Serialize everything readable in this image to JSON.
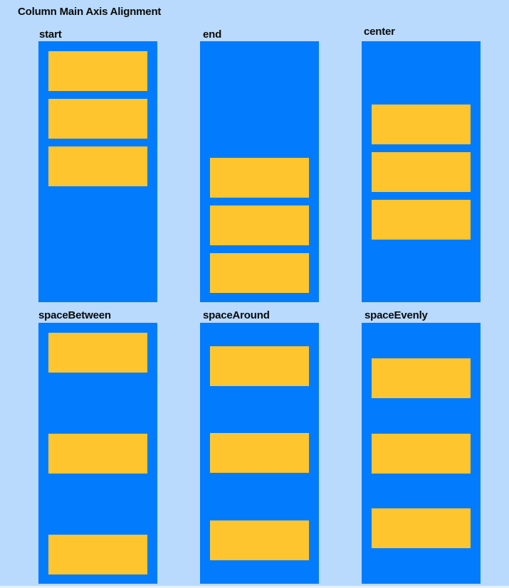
{
  "page": {
    "title": "Column Main Axis Alignment"
  },
  "colors": {
    "background": "#b9dafc",
    "panel": "#027cfd",
    "box": "#ffc52e"
  },
  "panels": [
    {
      "label": "start",
      "alignment": "start",
      "box_count": 3
    },
    {
      "label": "end",
      "alignment": "end",
      "box_count": 3
    },
    {
      "label": "center",
      "alignment": "center",
      "box_count": 3
    },
    {
      "label": "spaceBetween",
      "alignment": "spaceBetween",
      "box_count": 3
    },
    {
      "label": "spaceAround",
      "alignment": "spaceAround",
      "box_count": 3
    },
    {
      "label": "spaceEvenly",
      "alignment": "spaceEvenly",
      "box_count": 3
    }
  ]
}
